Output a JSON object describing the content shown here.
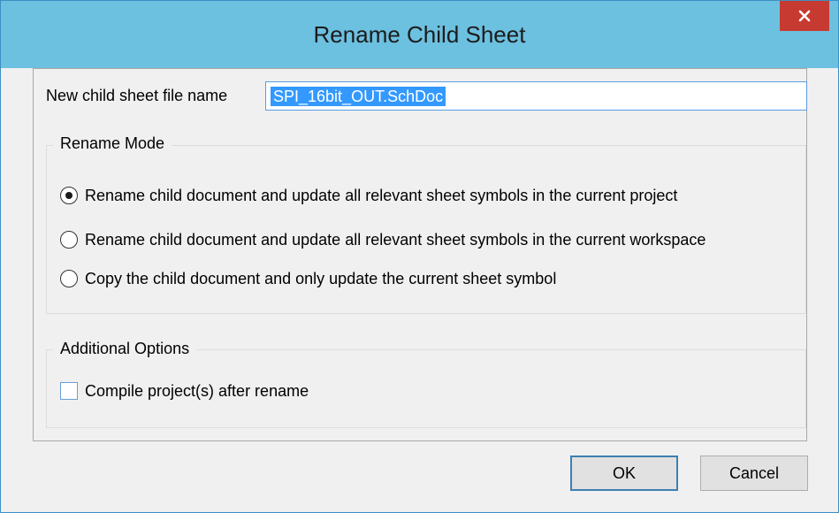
{
  "dialog": {
    "title": "Rename Child Sheet",
    "close_icon": "close-icon"
  },
  "filename": {
    "label": "New child sheet file name",
    "value": "SPI_16bit_OUT.SchDoc"
  },
  "rename_mode": {
    "title": "Rename Mode",
    "options": [
      {
        "label": "Rename child document and update all relevant sheet symbols in the current project",
        "selected": true
      },
      {
        "label": "Rename child document and update all relevant sheet symbols in the current workspace",
        "selected": false
      },
      {
        "label": "Copy the child document and only update the current sheet symbol",
        "selected": false
      }
    ]
  },
  "additional_options": {
    "title": "Additional Options",
    "compile_label": "Compile project(s) after rename",
    "compile_checked": false
  },
  "buttons": {
    "ok": "OK",
    "cancel": "Cancel"
  },
  "colors": {
    "titlebar": "#6cc0e0",
    "close": "#c73a31",
    "selection": "#3399ff"
  }
}
